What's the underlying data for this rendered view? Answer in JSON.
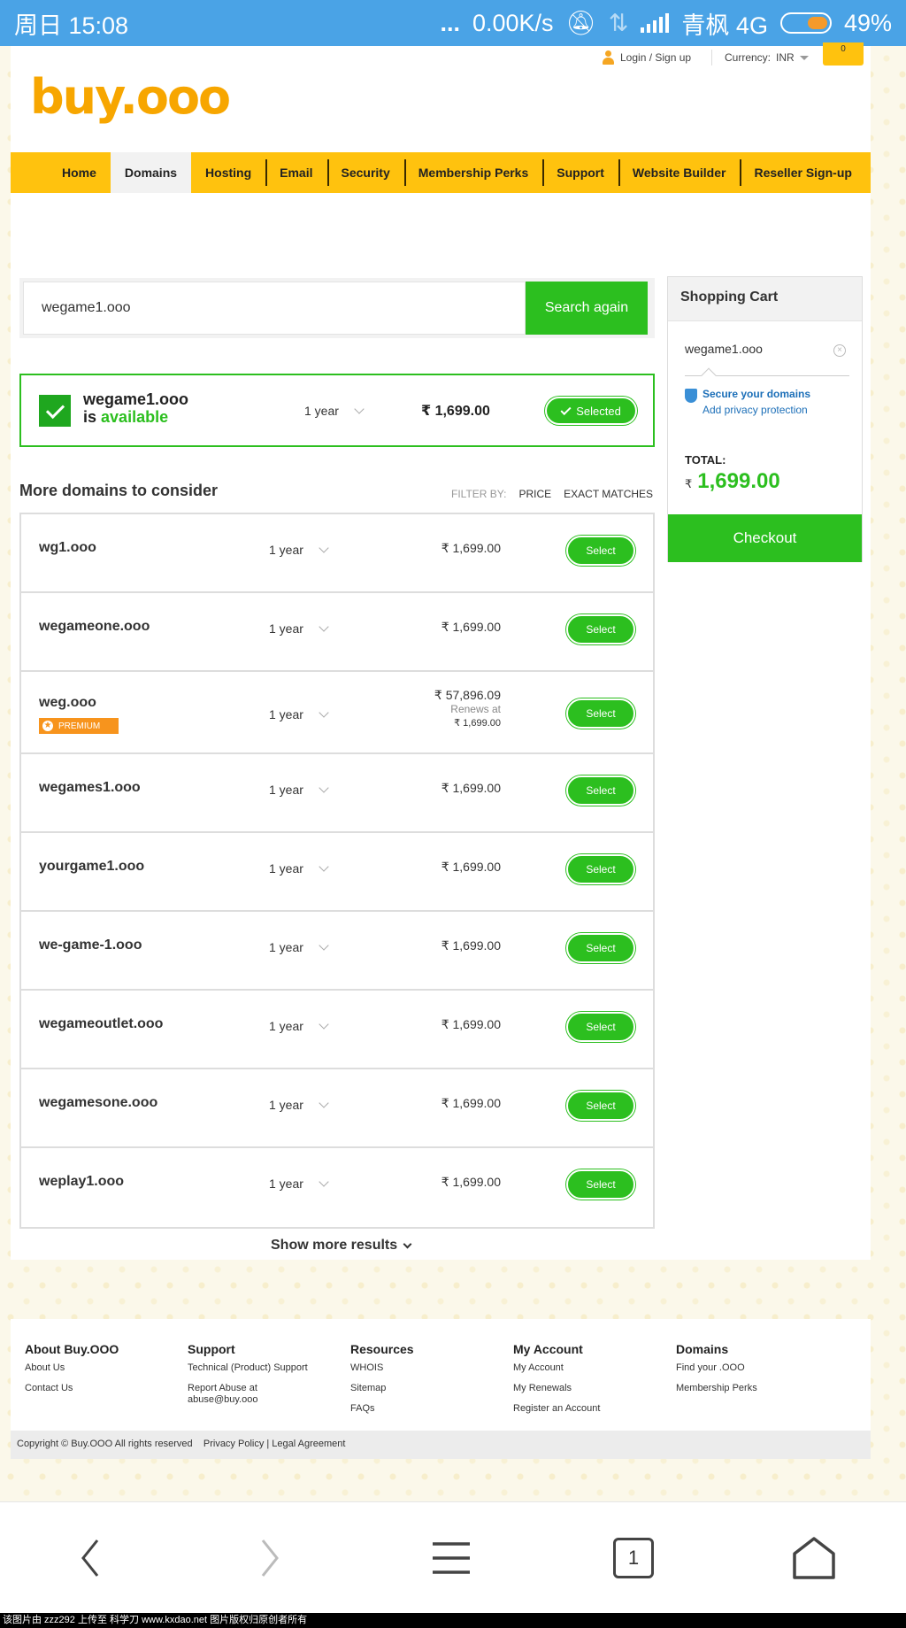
{
  "status_bar": {
    "left": "周日 15:08",
    "speed": "0.00K/s",
    "carrier": "青枫 4G",
    "battery": "49%",
    "dots": "..."
  },
  "utility": {
    "login": "Login / Sign up",
    "currency_label": "Currency:",
    "currency_value": "INR",
    "cart_count": "0"
  },
  "logo": {
    "text": "buy",
    "dot": ".",
    "suffix": "ooo"
  },
  "nav": [
    "Home",
    "Domains",
    "Hosting",
    "Email",
    "Security",
    "Membership Perks",
    "Support",
    "Website Builder",
    "Reseller Sign-up"
  ],
  "nav_active": "Domains",
  "search": {
    "value": "wegame1.ooo",
    "button": "Search again"
  },
  "available": {
    "domain": "wegame1.ooo",
    "is": "is",
    "status": "available",
    "period": "1 year",
    "price": "₹ 1,699.00",
    "button": "Selected"
  },
  "more": {
    "title": "More domains to consider",
    "filter_label": "FILTER BY:",
    "filter_price": "PRICE",
    "filter_exact": "EXACT MATCHES"
  },
  "rows": [
    {
      "name": "wg1.ooo",
      "period": "1 year",
      "price": "₹ 1,699.00",
      "button": "Select"
    },
    {
      "name": "wegameone.ooo",
      "period": "1 year",
      "price": "₹ 1,699.00",
      "button": "Select"
    },
    {
      "name": "weg.ooo",
      "badge": "PREMIUM",
      "period": "1 year",
      "price": "₹ 57,896.09",
      "renews_label": "Renews at",
      "renews_price": "₹ 1,699.00",
      "button": "Select"
    },
    {
      "name": "wegames1.ooo",
      "period": "1 year",
      "price": "₹ 1,699.00",
      "button": "Select"
    },
    {
      "name": "yourgame1.ooo",
      "period": "1 year",
      "price": "₹ 1,699.00",
      "button": "Select"
    },
    {
      "name": "we-game-1.ooo",
      "period": "1 year",
      "price": "₹ 1,699.00",
      "button": "Select"
    },
    {
      "name": "wegameoutlet.ooo",
      "period": "1 year",
      "price": "₹ 1,699.00",
      "button": "Select"
    },
    {
      "name": "wegamesone.ooo",
      "period": "1 year",
      "price": "₹ 1,699.00",
      "button": "Select"
    },
    {
      "name": "weplay1.ooo",
      "period": "1 year",
      "price": "₹ 1,699.00",
      "button": "Select"
    }
  ],
  "show_more": "Show more results",
  "cart": {
    "title": "Shopping Cart",
    "domain": "wegame1.ooo",
    "remove": "×",
    "secure": "Secure your domains",
    "privacy": "Add privacy protection",
    "total_label": "TOTAL:",
    "currency": "₹",
    "total": "1,699.00",
    "checkout": "Checkout"
  },
  "footer": {
    "cols": [
      {
        "title": "About Buy.OOO",
        "links": [
          "About Us",
          "Contact Us"
        ]
      },
      {
        "title": "Support",
        "links": [
          "Technical (Product) Support",
          "Report Abuse at abuse@buy.ooo"
        ]
      },
      {
        "title": "Resources",
        "links": [
          "WHOIS",
          "Sitemap",
          "FAQs"
        ]
      },
      {
        "title": "My Account",
        "links": [
          "My Account",
          "My Renewals",
          "Register an Account"
        ]
      },
      {
        "title": "Domains",
        "links": [
          "Find your .OOO",
          "Membership Perks"
        ]
      }
    ],
    "copyright": "Copyright © Buy.OOO All rights reserved",
    "policy": "Privacy Policy | Legal Agreement"
  },
  "browser": {
    "tab_count": "1"
  },
  "watermark": "该图片由 zzz292 上传至 科学刀 www.kxdao.net 图片版权归原创者所有",
  "colors": {
    "accent_green": "#2cbf1f",
    "nav_yellow": "#ffc20e",
    "status_blue": "#4aa3e6",
    "logo_orange": "#f7a600"
  }
}
